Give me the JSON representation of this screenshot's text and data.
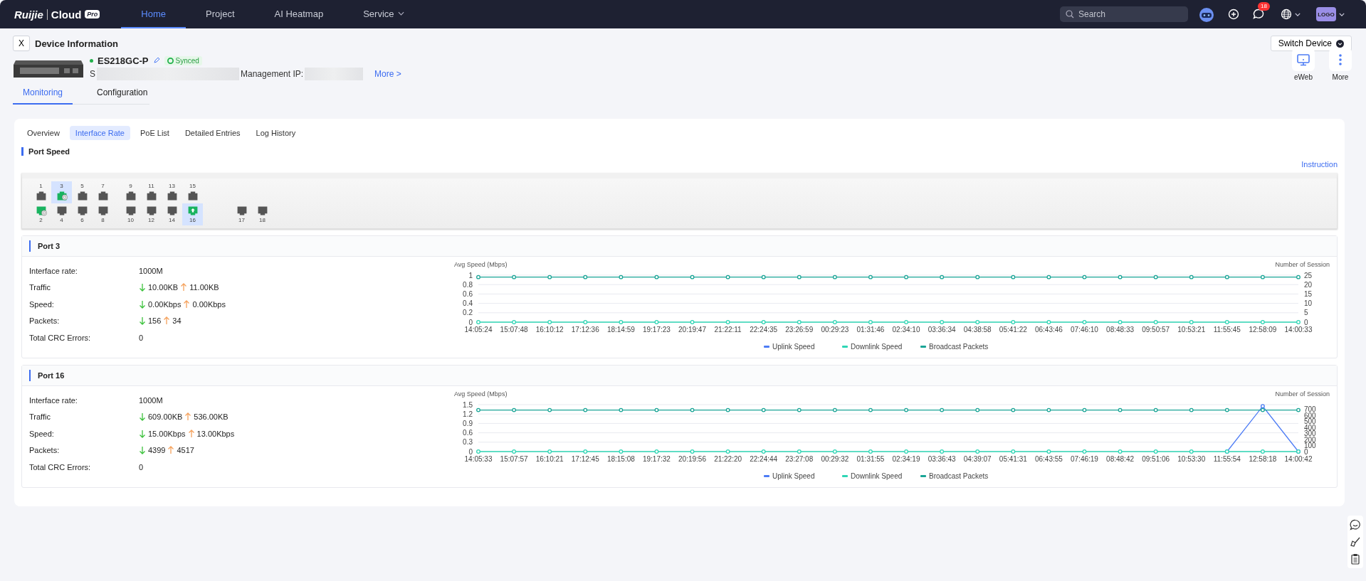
{
  "nav": {
    "logo": {
      "brand": "Ruijie",
      "product": "Cloud",
      "edition": "Pro"
    },
    "items": [
      {
        "label": "Home",
        "selected": true,
        "dropdown": false
      },
      {
        "label": "Project",
        "selected": false,
        "dropdown": false
      },
      {
        "label": "AI Heatmap",
        "selected": false,
        "dropdown": false
      },
      {
        "label": "Service",
        "selected": false,
        "dropdown": true
      }
    ],
    "search": {
      "placeholder": "Search"
    },
    "notifications": "18",
    "avatar": "LOGO"
  },
  "header": {
    "close": "X",
    "title": "Device Information",
    "switch_button": "Switch Device",
    "device": {
      "online": true,
      "name": "ES218GC-P",
      "sync_status": "Synced",
      "serial_label": "S",
      "ip_label": "Management IP:",
      "more_link": "More >"
    },
    "actions": [
      {
        "label": "eWeb",
        "kind": "monitor"
      },
      {
        "label": "More",
        "kind": "menu"
      }
    ],
    "tabs": [
      {
        "label": "Monitoring",
        "selected": true
      },
      {
        "label": "Configuration",
        "selected": false
      }
    ]
  },
  "subtabs": [
    {
      "label": "Overview",
      "selected": false
    },
    {
      "label": "Interface Rate",
      "selected": true
    },
    {
      "label": "PoE List",
      "selected": false
    },
    {
      "label": "Detailed Entries",
      "selected": false
    },
    {
      "label": "Log History",
      "selected": false
    }
  ],
  "section_title": "Port Speed",
  "instruction_link": "Instruction",
  "switch_panel": {
    "groups": [
      [
        {
          "top": {
            "label": "1",
            "link": false,
            "selected": false,
            "kind": "plain"
          },
          "bottom": {
            "label": "2",
            "link": true,
            "selected": false,
            "kind": "ring"
          }
        },
        {
          "top": {
            "label": "3",
            "link": true,
            "selected": true,
            "kind": "ring"
          },
          "bottom": {
            "label": "4",
            "link": false,
            "selected": false,
            "kind": "plain"
          }
        },
        {
          "top": {
            "label": "5",
            "link": false,
            "selected": false,
            "kind": "plain"
          },
          "bottom": {
            "label": "6",
            "link": false,
            "selected": false,
            "kind": "plain"
          }
        },
        {
          "top": {
            "label": "7",
            "link": false,
            "selected": false,
            "kind": "plain"
          },
          "bottom": {
            "label": "8",
            "link": false,
            "selected": false,
            "kind": "plain"
          }
        }
      ],
      [
        {
          "top": {
            "label": "9",
            "link": false,
            "selected": false,
            "kind": "plain"
          },
          "bottom": {
            "label": "10",
            "link": false,
            "selected": false,
            "kind": "plain"
          }
        },
        {
          "top": {
            "label": "11",
            "link": false,
            "selected": false,
            "kind": "plain"
          },
          "bottom": {
            "label": "12",
            "link": false,
            "selected": false,
            "kind": "plain"
          }
        },
        {
          "top": {
            "label": "13",
            "link": false,
            "selected": false,
            "kind": "plain"
          },
          "bottom": {
            "label": "14",
            "link": false,
            "selected": false,
            "kind": "plain"
          }
        },
        {
          "top": {
            "label": "15",
            "link": false,
            "selected": false,
            "kind": "plain"
          },
          "bottom": {
            "label": "16",
            "link": true,
            "selected": true,
            "kind": "uplink"
          }
        }
      ],
      [
        {
          "bottom": {
            "label": "17",
            "link": false,
            "selected": false,
            "kind": "plain"
          }
        },
        {
          "bottom": {
            "label": "18",
            "link": false,
            "selected": false,
            "kind": "plain"
          }
        }
      ]
    ]
  },
  "ports": [
    {
      "title": "Port 3",
      "info": [
        {
          "kind": "plain",
          "label": "Interface rate:",
          "value": "1000M"
        },
        {
          "kind": "updown",
          "label": "Traffic",
          "down": "10.00KB",
          "up": "11.00KB"
        },
        {
          "kind": "updown",
          "label": "Speed:",
          "down": "0.00Kbps",
          "up": "0.00Kbps"
        },
        {
          "kind": "updown",
          "label": "Packets:",
          "down": "156",
          "up": "34"
        },
        {
          "kind": "plain",
          "label": "Total CRC Errors:",
          "value": "0"
        }
      ],
      "chart_data": {
        "type": "line",
        "ylabel": "Avg Speed (Mbps)",
        "ylim": [
          0,
          1
        ],
        "yticks": [
          {
            "value": 0,
            "label": "0"
          },
          {
            "value": 0.2,
            "label": "0.2"
          },
          {
            "value": 0.4,
            "label": "0.4"
          },
          {
            "value": 0.6,
            "label": "0.6"
          },
          {
            "value": 0.8,
            "label": "0.8"
          },
          {
            "value": 1,
            "label": "1"
          }
        ],
        "y2label": "Number of Session",
        "y2lim": [
          0,
          25
        ],
        "y2ticks": [
          {
            "value": 0,
            "label": "0"
          },
          {
            "value": 5,
            "label": "5"
          },
          {
            "value": 10,
            "label": "10"
          },
          {
            "value": 15,
            "label": "15"
          },
          {
            "value": 20,
            "label": "20"
          },
          {
            "value": 25,
            "label": "25"
          }
        ],
        "grid": true,
        "legend": true,
        "categories": [
          "14:05:24",
          "15:07:48",
          "16:10:12",
          "17:12:36",
          "18:14:59",
          "19:17:23",
          "20:19:47",
          "21:22:11",
          "22:24:35",
          "23:26:59",
          "00:29:23",
          "01:31:46",
          "02:34:10",
          "03:36:34",
          "04:38:58",
          "05:41:22",
          "06:43:46",
          "07:46:10",
          "08:48:33",
          "09:50:57",
          "10:53:21",
          "11:55:45",
          "12:58:09",
          "14:00:33"
        ],
        "series": [
          {
            "name": "Uplink Speed",
            "color": "#4d7cf5",
            "values": [
              null,
              null,
              null,
              null,
              null,
              null,
              null,
              null,
              null,
              null,
              null,
              null,
              null,
              null,
              null,
              null,
              null,
              null,
              null,
              null,
              null,
              null,
              null,
              null
            ]
          },
          {
            "name": "Downlink Speed",
            "color": "#2fd6b5",
            "marker": "circle",
            "values": [
              0,
              0,
              0,
              0,
              0,
              0,
              0,
              0,
              0,
              0,
              0,
              0,
              0,
              0,
              0,
              0,
              0,
              0,
              0,
              0,
              0,
              0,
              0,
              0
            ]
          },
          {
            "name": "Broadcast Packets",
            "color": "#1aa596",
            "marker": "circle",
            "axis": "y2",
            "values": [
              24,
              24,
              24,
              24,
              24,
              24,
              24,
              24,
              24,
              24,
              24,
              24,
              24,
              24,
              24,
              24,
              24,
              24,
              24,
              24,
              24,
              24,
              24,
              24
            ]
          }
        ]
      }
    },
    {
      "title": "Port 16",
      "info": [
        {
          "kind": "plain",
          "label": "Interface rate:",
          "value": "1000M"
        },
        {
          "kind": "updown",
          "label": "Traffic",
          "down": "609.00KB",
          "up": "536.00KB"
        },
        {
          "kind": "updown",
          "label": "Speed:",
          "down": "15.00Kbps",
          "up": "13.00Kbps"
        },
        {
          "kind": "updown",
          "label": "Packets:",
          "down": "4399",
          "up": "4517"
        },
        {
          "kind": "plain",
          "label": "Total CRC Errors:",
          "value": "0"
        }
      ],
      "chart_data": {
        "type": "line",
        "ylabel": "Avg Speed (Mbps)",
        "ylim": [
          0,
          1.5
        ],
        "yticks": [
          {
            "value": 0,
            "label": "0"
          },
          {
            "value": 0.3,
            "label": "0.3"
          },
          {
            "value": 0.6,
            "label": "0.6"
          },
          {
            "value": 0.9,
            "label": "0.9"
          },
          {
            "value": 1.2,
            "label": "1.2"
          },
          {
            "value": 1.5,
            "label": "1.5"
          }
        ],
        "y2label": "Number of Session",
        "y2lim": [
          0,
          780
        ],
        "y2ticks": [
          {
            "value": 0,
            "label": "0"
          },
          {
            "value": 100,
            "label": "100"
          },
          {
            "value": 200,
            "label": "200"
          },
          {
            "value": 300,
            "label": "300"
          },
          {
            "value": 400,
            "label": "400"
          },
          {
            "value": 500,
            "label": "500"
          },
          {
            "value": 600,
            "label": "600"
          },
          {
            "value": 700,
            "label": "700"
          }
        ],
        "grid": true,
        "legend": true,
        "categories": [
          "14:05:33",
          "15:07:57",
          "16:10:21",
          "17:12:45",
          "18:15:08",
          "19:17:32",
          "20:19:56",
          "21:22:20",
          "22:24:44",
          "23:27:08",
          "00:29:32",
          "01:31:55",
          "02:34:19",
          "03:36:43",
          "04:39:07",
          "05:41:31",
          "06:43:55",
          "07:46:19",
          "08:48:42",
          "09:51:06",
          "10:53:30",
          "11:55:54",
          "12:58:18",
          "14:00:42"
        ],
        "series": [
          {
            "name": "Uplink Speed",
            "color": "#4d7cf5",
            "marker": "circle",
            "values": [
              null,
              null,
              null,
              null,
              null,
              null,
              null,
              null,
              null,
              null,
              null,
              null,
              null,
              null,
              null,
              null,
              null,
              null,
              null,
              null,
              null,
              0,
              1.45,
              0
            ]
          },
          {
            "name": "Downlink Speed",
            "color": "#2fd6b5",
            "marker": "circle",
            "values": [
              0,
              0,
              0,
              0,
              0,
              0,
              0,
              0,
              0,
              0,
              0,
              0,
              0,
              0,
              0,
              0,
              0,
              0,
              0,
              0,
              0,
              0,
              0,
              0
            ]
          },
          {
            "name": "Broadcast Packets",
            "color": "#1aa596",
            "marker": "circle",
            "axis": "y2",
            "values": [
              690,
              690,
              690,
              690,
              690,
              690,
              690,
              690,
              690,
              690,
              690,
              690,
              690,
              690,
              690,
              690,
              690,
              690,
              690,
              690,
              690,
              690,
              690,
              690
            ]
          }
        ]
      }
    }
  ]
}
